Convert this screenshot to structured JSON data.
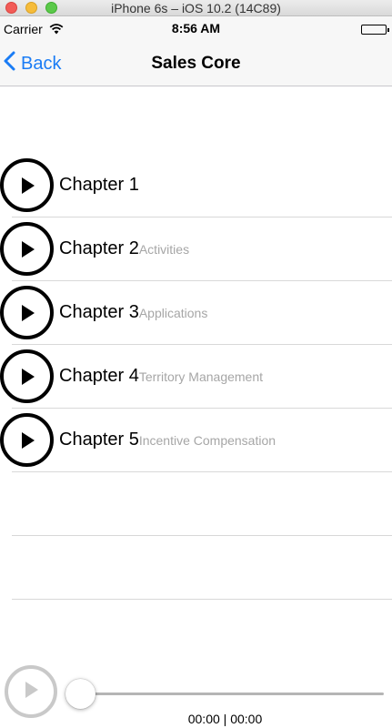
{
  "simulator": {
    "title": "iPhone 6s – iOS 10.2 (14C89)"
  },
  "status_bar": {
    "carrier": "Carrier",
    "time": "8:56 AM",
    "battery_level": 1.0
  },
  "nav": {
    "back_label": "Back",
    "title": "Sales Core"
  },
  "chapters": [
    {
      "title": "Chapter 1",
      "subtitle": ""
    },
    {
      "title": "Chapter 2",
      "subtitle": "Activities"
    },
    {
      "title": "Chapter 3",
      "subtitle": "Applications"
    },
    {
      "title": "Chapter 4",
      "subtitle": "Territory Management"
    },
    {
      "title": "Chapter 5",
      "subtitle": "Incentive Compensation"
    }
  ],
  "player": {
    "elapsed": "00:00",
    "total": "00:00",
    "progress": 0
  },
  "colors": {
    "tint": "#1a7cf5",
    "subtitle": "#a6a6a6",
    "separator": "#d8d8d8",
    "disabled": "#c9c9c9"
  },
  "icons": {
    "back": "chevron-left-icon",
    "play": "play-icon",
    "wifi": "wifi-icon",
    "battery": "battery-icon"
  }
}
